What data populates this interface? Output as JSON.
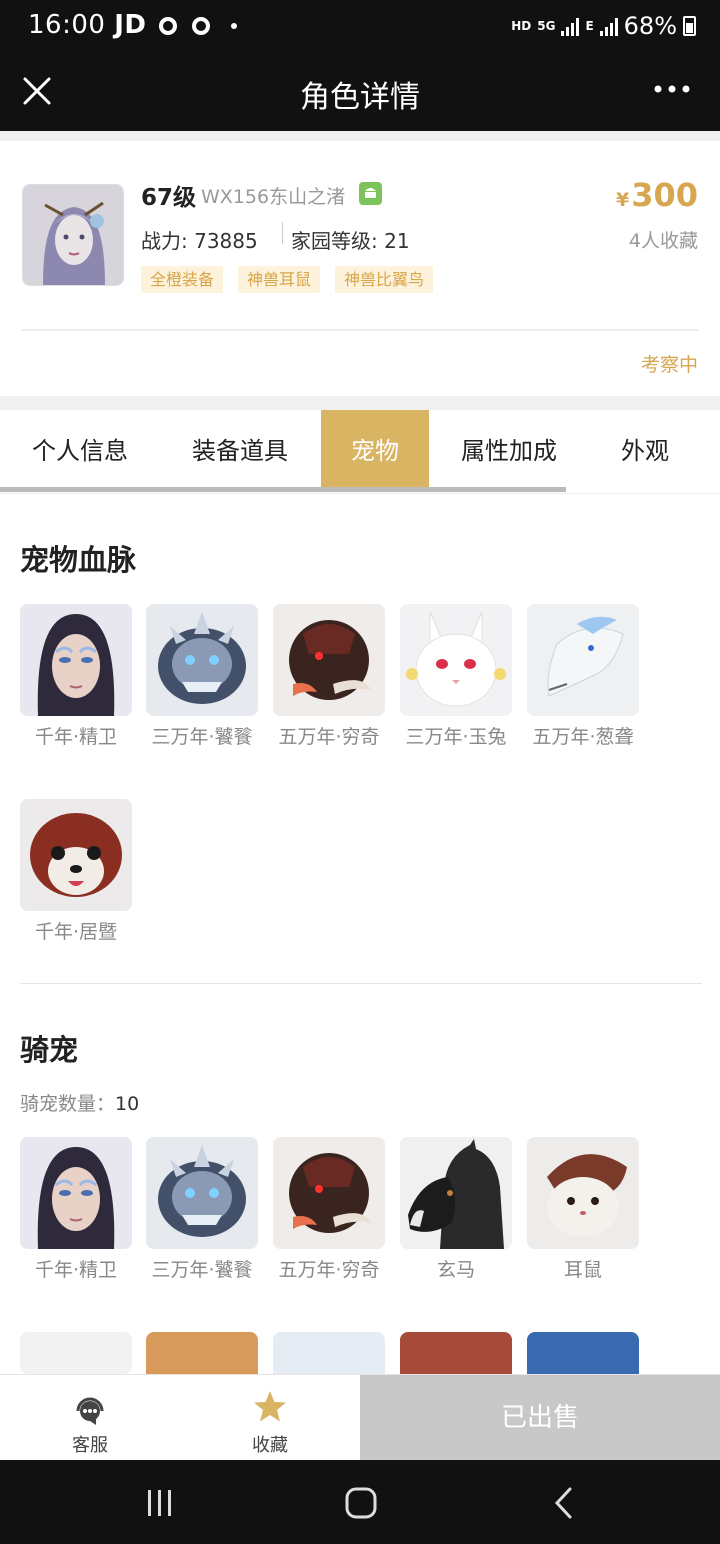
{
  "status_bar": {
    "time": "16:00",
    "carrier": "JD",
    "net_small": "HD",
    "net_gen": "5G",
    "net_e": "E",
    "battery": "68%"
  },
  "nav": {
    "title": "角色详情"
  },
  "role": {
    "level": "67级",
    "server": "WX156东山之渚",
    "power": "战力: 73885",
    "home_level": "家园等级: 21",
    "tags": [
      "全橙装备",
      "神兽耳鼠",
      "神兽比翼鸟"
    ],
    "price_currency": "¥",
    "price": "300",
    "favorites": "4人收藏",
    "status": "考察中"
  },
  "tabs": [
    "个人信息",
    "装备道具",
    "宠物",
    "属性加成",
    "外观"
  ],
  "active_tab": "宠物",
  "pet_bloodline": {
    "title": "宠物血脉",
    "items": [
      "千年·精卫",
      "三万年·饕餮",
      "五万年·穷奇",
      "三万年·玉兔",
      "五万年·葱聋",
      "千年·居暨"
    ]
  },
  "mounts": {
    "title": "骑宠",
    "count_label": "骑宠数量：",
    "count": "10",
    "items": [
      "千年·精卫",
      "三万年·饕餮",
      "五万年·穷奇",
      "玄马",
      "耳鼠"
    ]
  },
  "bottom": {
    "service": "客服",
    "favorite": "收藏",
    "sold": "已出售"
  },
  "colors": {
    "accent": "#d9b463",
    "price": "#d7a650",
    "tag_bg": "#fdf3dc"
  }
}
